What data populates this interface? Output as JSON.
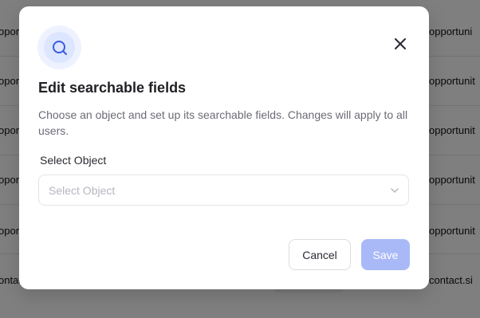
{
  "background": {
    "rows": [
      {
        "left": "oport",
        "right": "opportuni"
      },
      {
        "left": "oport",
        "right": "opportunit"
      },
      {
        "left": "oport",
        "right": "opportunit"
      },
      {
        "left": "oport",
        "right": "opportunit"
      },
      {
        "left": "oport",
        "right": "opportunit"
      },
      {
        "left": "ontac",
        "right": "contact.si"
      }
    ]
  },
  "modal": {
    "icon": "search-icon",
    "title": "Edit searchable fields",
    "description": "Choose an object and set up its searchable fields. Changes will apply to all users.",
    "field_label": "Select Object",
    "select_placeholder": "Select Object",
    "cancel_label": "Cancel",
    "save_label": "Save",
    "accent_color": "#a9b9f7"
  }
}
